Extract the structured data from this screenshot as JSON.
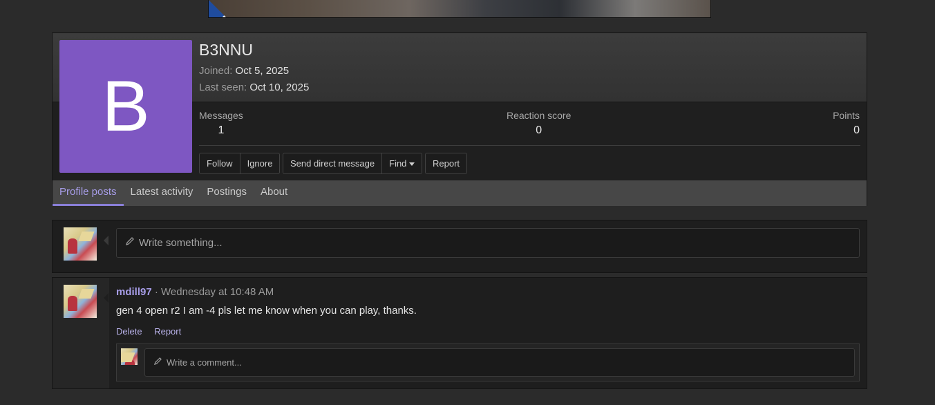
{
  "banner": {
    "icon": "banner-ad-image"
  },
  "profile": {
    "avatar_letter": "B",
    "avatar_color": "#7e57c2",
    "username": "B3NNU",
    "joined_label": "Joined:",
    "joined_value": "Oct 5, 2025",
    "last_seen_label": "Last seen:",
    "last_seen_value": "Oct 10, 2025",
    "stats": {
      "messages_label": "Messages",
      "messages_value": "1",
      "reaction_label": "Reaction score",
      "reaction_value": "0",
      "points_label": "Points",
      "points_value": "0"
    },
    "buttons": {
      "follow": "Follow",
      "ignore": "Ignore",
      "send_dm": "Send direct message",
      "find": "Find",
      "report": "Report"
    },
    "tabs": [
      "Profile posts",
      "Latest activity",
      "Postings",
      "About"
    ],
    "active_tab": "Profile posts"
  },
  "composer": {
    "placeholder": "Write something..."
  },
  "post": {
    "author": "mdill97",
    "separator": "·",
    "time": "Wednesday at 10:48 AM",
    "body": "gen 4 open r2 I am -4 pls let me know when you can play, thanks.",
    "actions": {
      "delete": "Delete",
      "report": "Report"
    },
    "comment_placeholder": "Write a comment..."
  },
  "colors": {
    "accent": "#a79de8",
    "page_bg": "#2b2b2b"
  }
}
